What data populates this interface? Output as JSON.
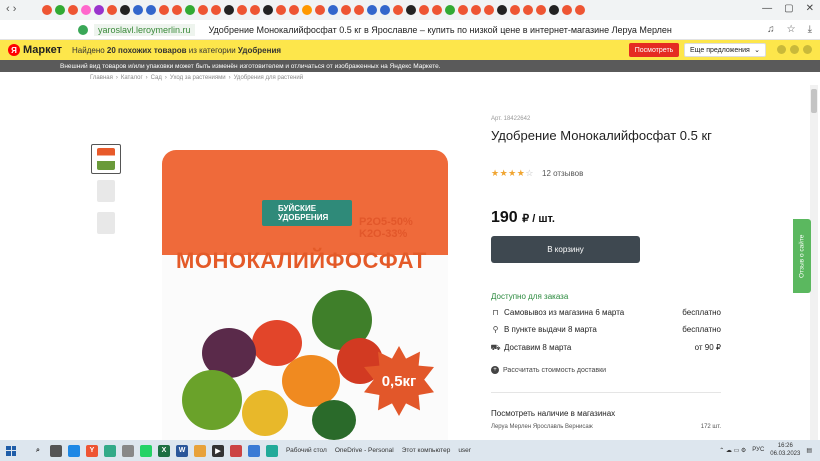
{
  "browser": {
    "url": "yaroslavl.leroymerlin.ru",
    "tab_title": "Удобрение Монокалийфосфат 0.5 кг в Ярославле – купить по низкой цене в интернет-магазине Леруа Мерлен"
  },
  "market_bar": {
    "logo": "Маркет",
    "text_pre": "Найдено",
    "count_text": "20 похожих товаров",
    "text_mid": "из категории",
    "category": "Удобрения",
    "view_button": "Посмотреть",
    "more_select": "Еще предложения",
    "disclaimer": "Внешний вид товаров и/или упаковки может быть изменён изготовителем и отличаться от изображенных на Яндекс Маркете."
  },
  "breadcrumbs": [
    "Главная",
    "Каталог",
    "Сад",
    "Уход за растениями",
    "Удобрения для растений"
  ],
  "product": {
    "article": "Арт. 18422642",
    "title": "Удобрение Монокалийфосфат 0.5 кг",
    "rating_stars": 3.5,
    "reviews": "12 отзывов",
    "price": "190",
    "currency_unit": "₽ / шт.",
    "cart_button": "В корзину",
    "package": {
      "brand": "БУЙСКИЕ УДОБРЕНИЯ",
      "formula1": "P2O5-50%",
      "formula2": "K2O-33%",
      "name": "МОНОКАЛИЙФОСФАТ",
      "weight": "0,5кг"
    }
  },
  "delivery": {
    "available": "Доступно для заказа",
    "rows": [
      {
        "icon": "bag-icon",
        "label": "Самовывоз из магазина 6 марта",
        "value": "бесплатно"
      },
      {
        "icon": "pin-icon",
        "label": "В пункте выдачи 8 марта",
        "value": "бесплатно"
      },
      {
        "icon": "truck-icon",
        "label": "Доставим 8 марта",
        "value": "от 90 ₽"
      }
    ],
    "calc_link": "Рассчитать стоимость доставки"
  },
  "stock": {
    "title": "Посмотреть наличие в магазинах",
    "store": "Леруа Мерлен Ярославль Вернисаж",
    "qty": "172 шт."
  },
  "feedback_tab": "Отзыв о сайте",
  "taskbar": {
    "desktop": "Рабочий стол",
    "onedrive": "OneDrive - Personal",
    "this_pc": "Этот компьютер",
    "user": "user",
    "lang": "РУС",
    "time": "16:26",
    "date": "06.03.2023"
  },
  "colors": {
    "market_bar": "#fde64b",
    "cart": "#3e4850",
    "available": "#2b8a3e",
    "feedback": "#5bb85f"
  }
}
